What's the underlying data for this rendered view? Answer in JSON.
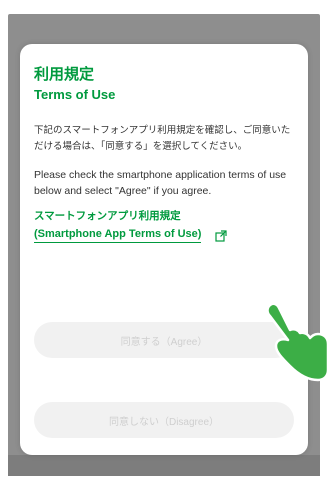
{
  "dialog": {
    "title_ja": "利用規定",
    "title_en": "Terms of Use",
    "text_ja": "下記のスマートフォンアプリ利用規定を確認し、ご同意いただける場合は、「同意する」を選択してください。",
    "text_en": "Please check the smartphone application terms of use below and select \"Agree\" if you agree.",
    "link_ja": "スマートフォンアプリ利用規定",
    "link_en": "(Smartphone App Terms of Use)",
    "agree_label": "同意する（Agree）",
    "disagree_label": "同意しない（Disagree）"
  },
  "icons": {
    "external_link": "external-link-icon",
    "hand_pointer": "hand-pointer-icon"
  },
  "colors": {
    "accent": "#009a3e",
    "hand": "#3cae46",
    "button_bg": "#f1f1f1",
    "backdrop": "#8e8e8e"
  }
}
